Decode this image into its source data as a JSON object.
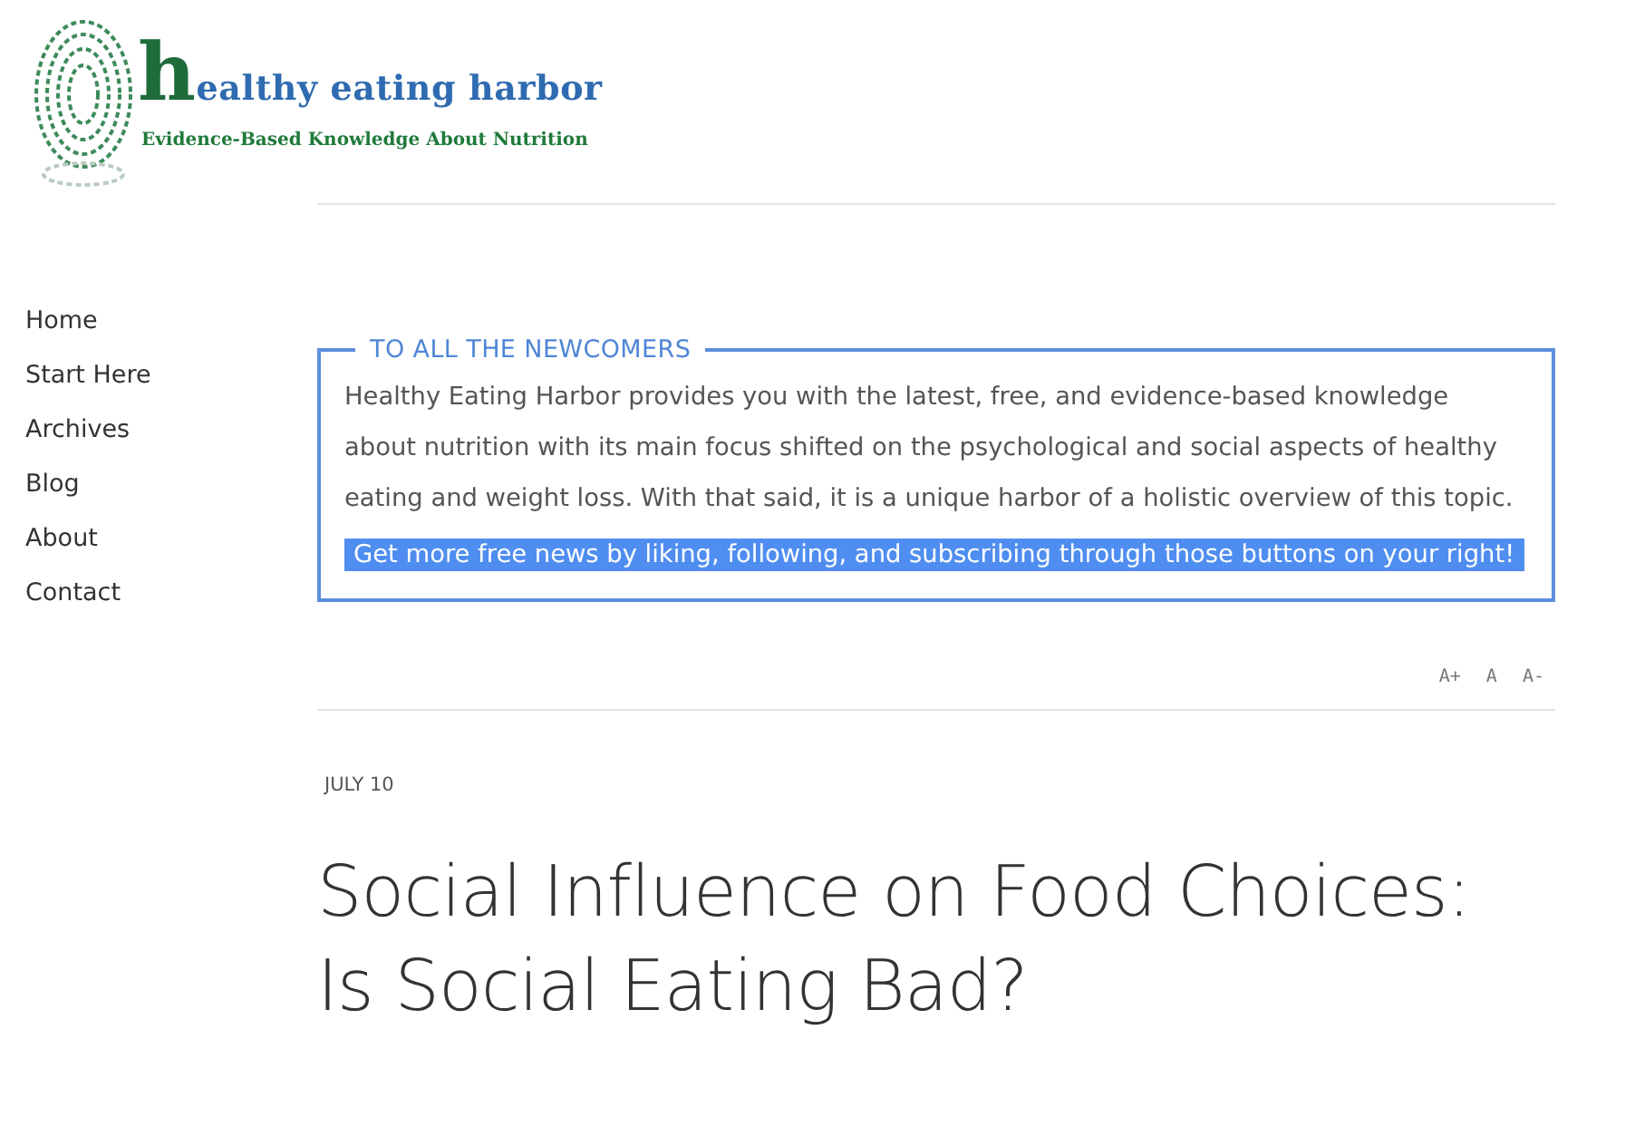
{
  "logo": {
    "title": "healthy eating harbor",
    "tagline": "Evidence-Based Knowledge About Nutrition"
  },
  "nav": [
    {
      "label": "Home"
    },
    {
      "label": "Start Here"
    },
    {
      "label": "Archives"
    },
    {
      "label": "Blog"
    },
    {
      "label": "About"
    },
    {
      "label": "Contact"
    }
  ],
  "notice": {
    "heading": "TO ALL THE NEWCOMERS",
    "text": "Healthy Eating Harbor provides you with the latest, free, and evidence-based knowledge about nutrition with its main focus shifted on the psychological and social aspects of healthy eating and weight loss. With that said, it is a unique harbor of a holistic overview of this topic.",
    "highlight": "Get more free news by liking, following, and subscribing through those buttons on your right!"
  },
  "font_controls": [
    "A+",
    "A",
    "A-"
  ],
  "post": {
    "date": "JULY 10",
    "title": "Social Influence on Food Choices: Is Social Eating Bad?"
  }
}
